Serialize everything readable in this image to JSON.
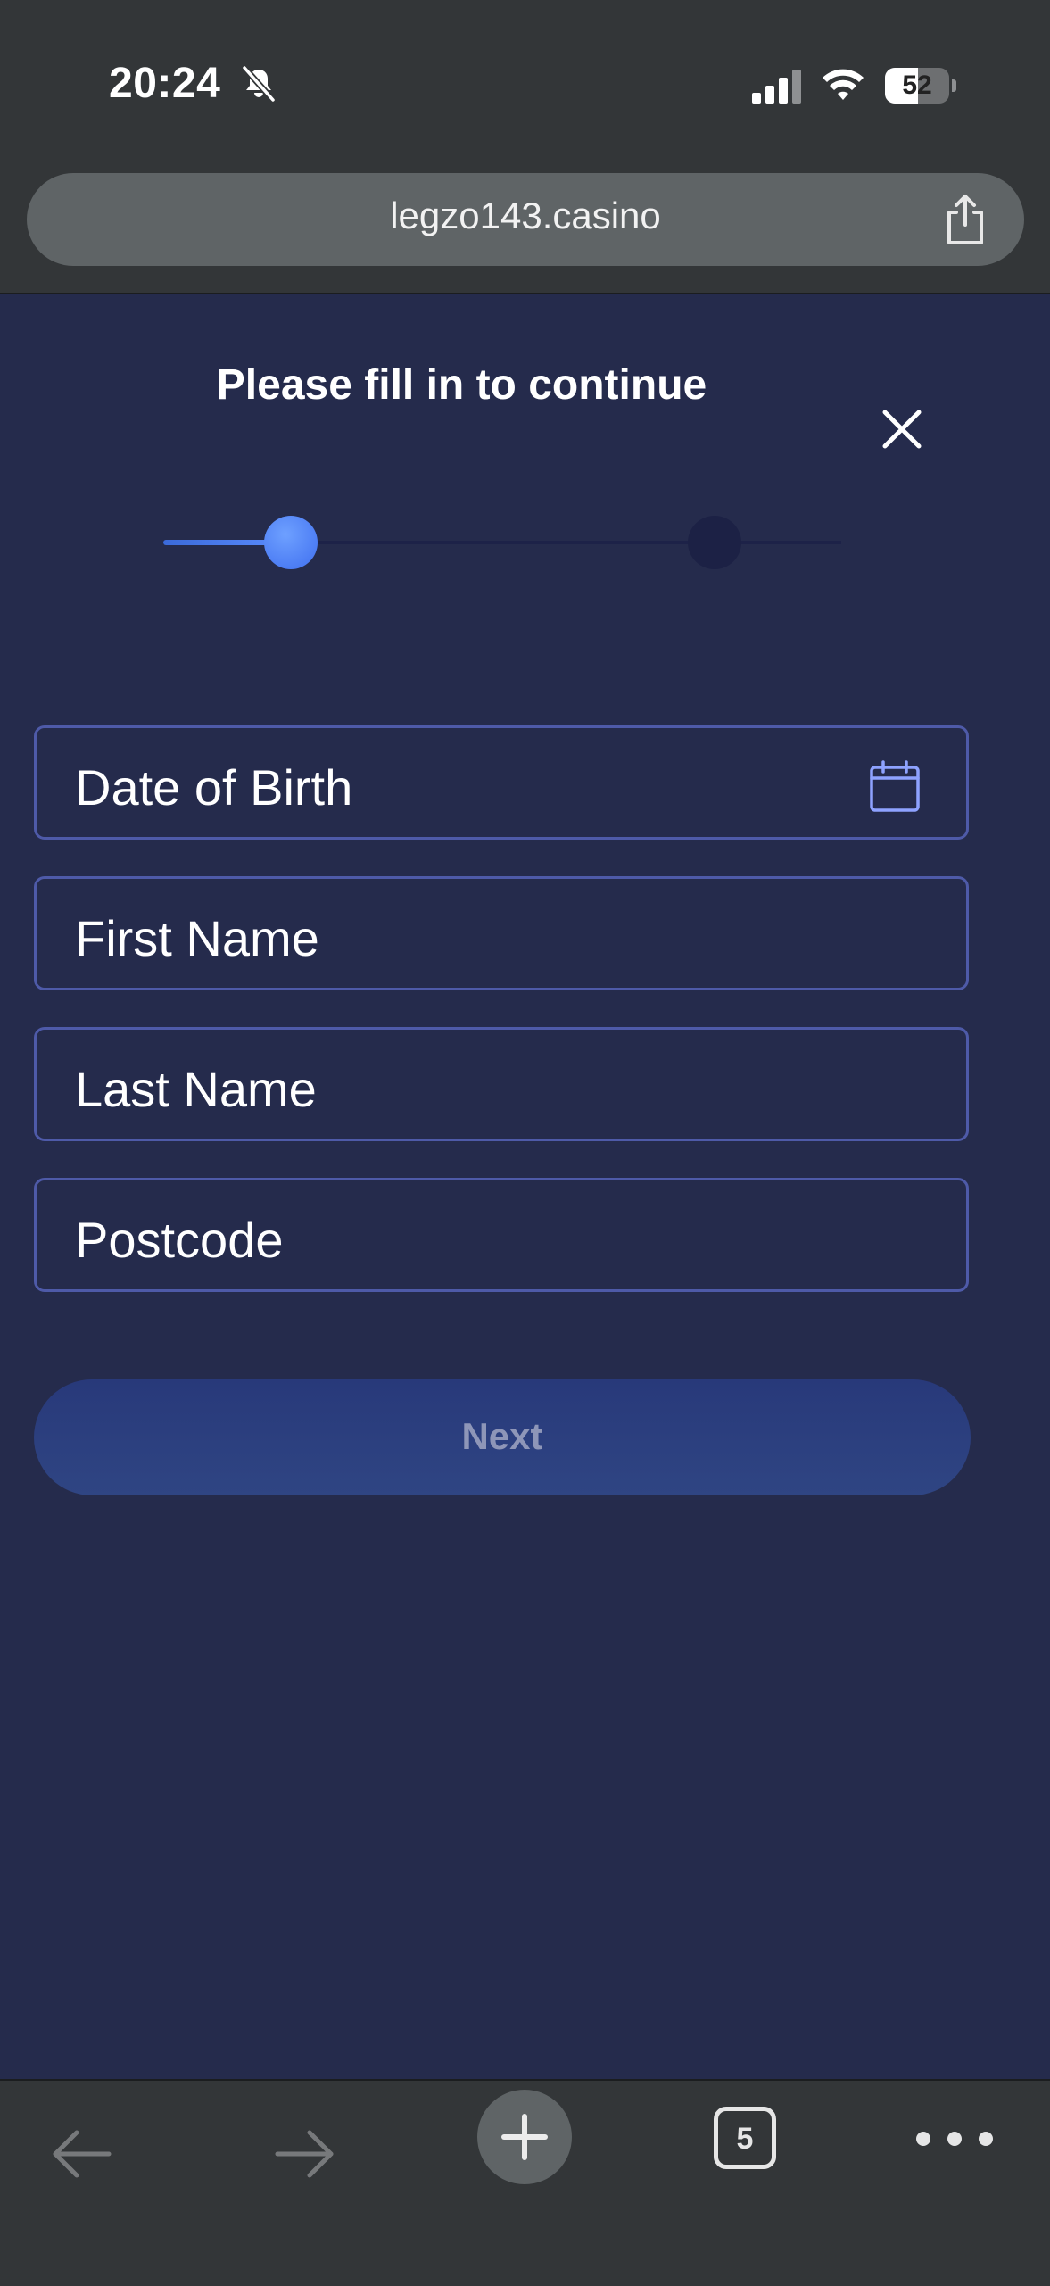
{
  "status_bar": {
    "time": "20:24",
    "battery_level": "52",
    "battery_fraction": 0.52,
    "icons": [
      "bell-slash-icon",
      "cellular-signal-icon",
      "wifi-icon",
      "battery-icon"
    ]
  },
  "browser": {
    "url": "legzo143.casino",
    "share_icon": "share-icon",
    "tab_count": "5",
    "toolbar_icons": [
      "back-arrow-icon",
      "forward-arrow-icon",
      "plus-icon",
      "tabs-icon",
      "more-dots-icon"
    ]
  },
  "form": {
    "title": "Please fill in to continue",
    "close_icon": "close-icon",
    "progress": {
      "current_step": 1,
      "total_steps": 2
    },
    "fields": {
      "dob": "Date of Birth",
      "first_name": "First Name",
      "last_name": "Last Name",
      "postcode": "Postcode"
    },
    "next_label": "Next"
  },
  "colors": {
    "page_background": "#252b4c",
    "field_border": "#4e5aa8",
    "accent": "#4f7ff5",
    "button_disabled": "#2b3d7e",
    "browser_chrome": "#333638"
  }
}
